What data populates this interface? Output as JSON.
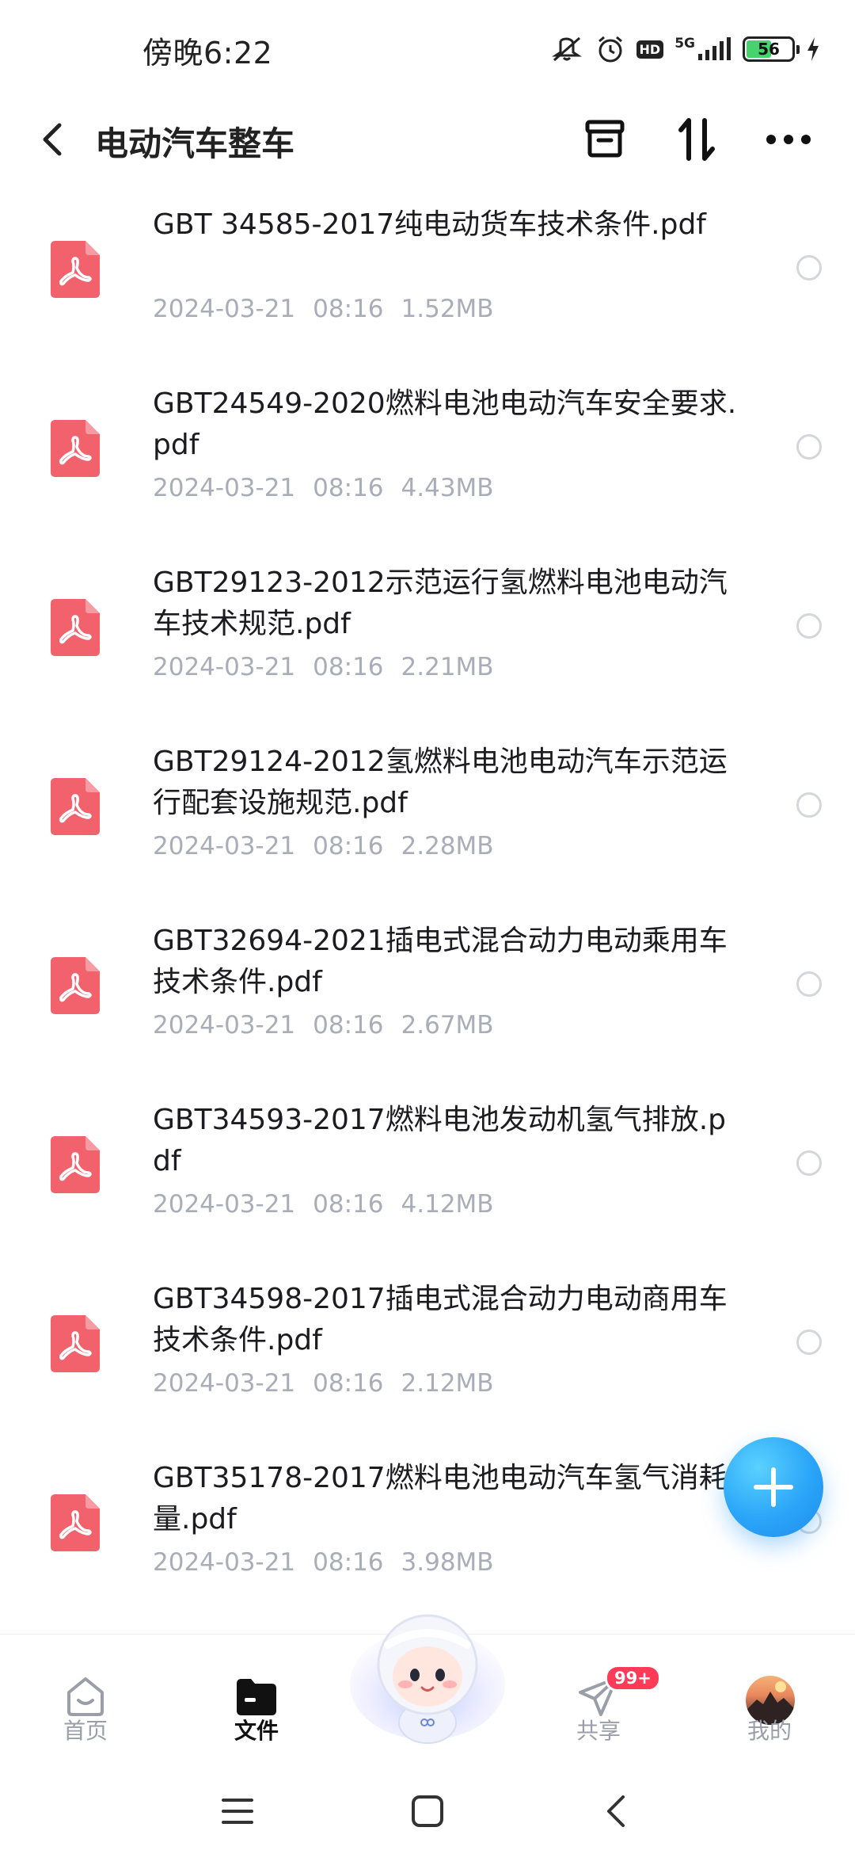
{
  "status": {
    "time": "傍晚6:22",
    "hd": "HD",
    "network": "5G",
    "battery": "56",
    "battery_level": 0.56
  },
  "header": {
    "title": "电动汽车整车"
  },
  "files": [
    {
      "name": "GBT 34585-2017纯电动货车技术条件.pdf",
      "date": "2024-03-21",
      "time": "08:16",
      "size": "1.52MB"
    },
    {
      "name": "GBT24549-2020燃料电池电动汽车安全要求.pdf",
      "date": "2024-03-21",
      "time": "08:16",
      "size": "4.43MB"
    },
    {
      "name": "GBT29123-2012示范运行氢燃料电池电动汽车技术规范.pdf",
      "date": "2024-03-21",
      "time": "08:16",
      "size": "2.21MB"
    },
    {
      "name": "GBT29124-2012氢燃料电池电动汽车示范运行配套设施规范.pdf",
      "date": "2024-03-21",
      "time": "08:16",
      "size": "2.28MB"
    },
    {
      "name": "GBT32694-2021插电式混合动力电动乘用车技术条件.pdf",
      "date": "2024-03-21",
      "time": "08:16",
      "size": "2.67MB"
    },
    {
      "name": "GBT34593-2017燃料电池发动机氢气排放.pdf",
      "date": "2024-03-21",
      "time": "08:16",
      "size": "4.12MB"
    },
    {
      "name": "GBT34598-2017插电式混合动力电动商用车技术条件.pdf",
      "date": "2024-03-21",
      "time": "08:16",
      "size": "2.12MB"
    },
    {
      "name": "GBT35178-2017燃料电池电动汽车氢气消耗量.pdf",
      "date": "2024-03-21",
      "time": "08:16",
      "size": "3.98MB"
    }
  ],
  "nav": {
    "home": "首页",
    "files": "文件",
    "share": "共享",
    "share_badge": "99+",
    "mine": "我的"
  },
  "colors": {
    "pdf_icon": "#f2626d",
    "fab": "#2aa5f8",
    "badge": "#ff3b57",
    "meta_text": "#a9adb8"
  }
}
